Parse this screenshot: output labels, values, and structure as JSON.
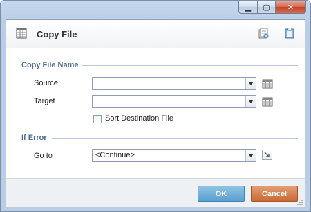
{
  "window": {
    "minimize_icon": "minimize-icon",
    "maximize_icon": "maximize-icon",
    "close_icon": "close-icon"
  },
  "header": {
    "title": "Copy File",
    "title_icon": "table-icon",
    "tools": [
      "add-document-icon",
      "clipboard-icon"
    ]
  },
  "sections": {
    "copy_file_name": {
      "title": "Copy File Name",
      "source_label": "Source",
      "source_value": "",
      "target_label": "Target",
      "target_value": "",
      "sort_label": "Sort Destination File",
      "sort_checked": false
    },
    "if_error": {
      "title": "If Error",
      "goto_label": "Go to",
      "goto_value": "<Continue>"
    }
  },
  "footer": {
    "ok_label": "OK",
    "cancel_label": "Cancel"
  },
  "colors": {
    "section_title": "#4d6e96",
    "ok_button": "#5aa0cf",
    "cancel_button": "#c96a36"
  }
}
